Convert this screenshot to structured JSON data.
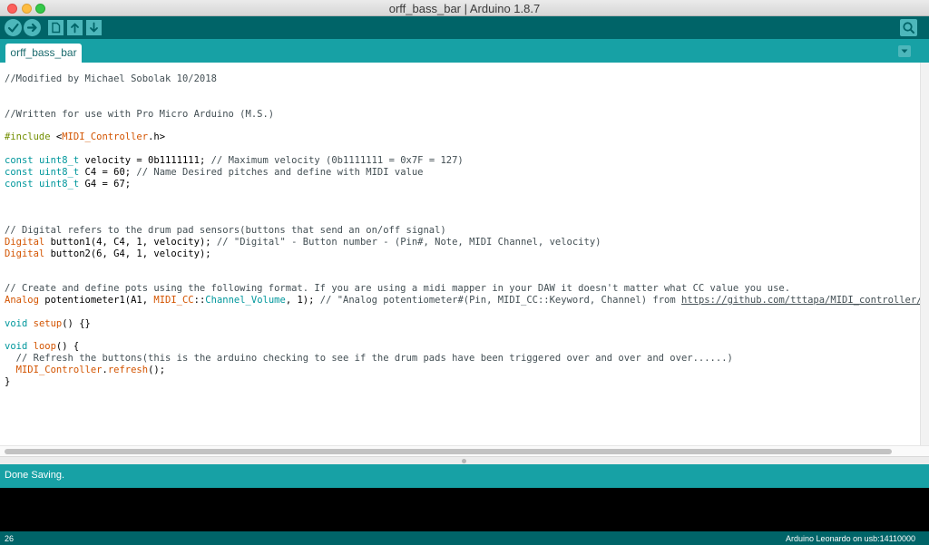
{
  "window": {
    "title": "orff_bass_bar | Arduino 1.8.7"
  },
  "toolbar": {
    "buttons": [
      {
        "name": "verify",
        "icon": "check-icon"
      },
      {
        "name": "upload",
        "icon": "arrow-right-icon"
      },
      {
        "name": "new",
        "icon": "new-file-icon"
      },
      {
        "name": "open",
        "icon": "arrow-up-icon"
      },
      {
        "name": "save",
        "icon": "arrow-down-icon"
      }
    ],
    "serial_monitor_icon": "magnifier-icon"
  },
  "tabs": [
    {
      "label": "orff_bass_bar",
      "active": true
    }
  ],
  "tab_menu_icon": "chevron-down-icon",
  "editor": {
    "lines": [
      [
        {
          "t": "//Modified by Michael Sobolak 10/2018",
          "c": "cm"
        }
      ],
      [],
      [],
      [
        {
          "t": "//Written for use with Pro Micro Arduino (M.S.)",
          "c": "cm"
        }
      ],
      [],
      [
        {
          "t": "#include",
          "c": "kw"
        },
        {
          "t": " <"
        },
        {
          "t": "MIDI_Controller",
          "c": "fn"
        },
        {
          "t": ".h>"
        }
      ],
      [],
      [
        {
          "t": "const",
          "c": "ty"
        },
        {
          "t": " "
        },
        {
          "t": "uint8_t",
          "c": "ty"
        },
        {
          "t": " velocity = 0b1111111; "
        },
        {
          "t": "// Maximum velocity (0b1111111 = 0x7F = 127)",
          "c": "cm"
        }
      ],
      [
        {
          "t": "const",
          "c": "ty"
        },
        {
          "t": " "
        },
        {
          "t": "uint8_t",
          "c": "ty"
        },
        {
          "t": " C4 = 60; "
        },
        {
          "t": "// Name Desired pitches and define with MIDI value",
          "c": "cm"
        }
      ],
      [
        {
          "t": "const",
          "c": "ty"
        },
        {
          "t": " "
        },
        {
          "t": "uint8_t",
          "c": "ty"
        },
        {
          "t": " G4 = 67;"
        }
      ],
      [],
      [],
      [],
      [
        {
          "t": "// Digital refers to the drum pad sensors(buttons that send an on/off signal)",
          "c": "cm"
        }
      ],
      [
        {
          "t": "Digital",
          "c": "fn"
        },
        {
          "t": " button1(4, C4, 1, velocity); "
        },
        {
          "t": "// \"Digital\" - Button number - (Pin#, Note, MIDI Channel, velocity)",
          "c": "cm"
        }
      ],
      [
        {
          "t": "Digital",
          "c": "fn"
        },
        {
          "t": " button2(6, G4, 1, velocity);"
        }
      ],
      [],
      [],
      [
        {
          "t": "// Create and define pots using the following format. If you are using a midi mapper in your DAW it doesn't matter what CC value you use.",
          "c": "cm"
        }
      ],
      [
        {
          "t": "Analog",
          "c": "fn"
        },
        {
          "t": " potentiometer1(A1, "
        },
        {
          "t": "MIDI_CC",
          "c": "fn"
        },
        {
          "t": "::"
        },
        {
          "t": "Channel_Volume",
          "c": "ty"
        },
        {
          "t": ", 1); "
        },
        {
          "t": "// \"Analog potentiometer#(Pin, MIDI_CC::Keyword, Channel) from ",
          "c": "cm"
        },
        {
          "t": "https://github.com/tttapa/MIDI_controller/blob/master/keywords",
          "c": "cm url"
        }
      ],
      [],
      [
        {
          "t": "void",
          "c": "ty"
        },
        {
          "t": " "
        },
        {
          "t": "setup",
          "c": "fn"
        },
        {
          "t": "() {}"
        }
      ],
      [],
      [
        {
          "t": "void",
          "c": "ty"
        },
        {
          "t": " "
        },
        {
          "t": "loop",
          "c": "fn"
        },
        {
          "t": "() {"
        }
      ],
      [
        {
          "t": "  "
        },
        {
          "t": "// Refresh the buttons(this is the arduino checking to see if the drum pads have been triggered over and over and over......)",
          "c": "cm"
        }
      ],
      [
        {
          "t": "  "
        },
        {
          "t": "MIDI_Controller",
          "c": "fn"
        },
        {
          "t": "."
        },
        {
          "t": "refresh",
          "c": "fn"
        },
        {
          "t": "();"
        }
      ],
      [
        {
          "t": "}"
        }
      ]
    ]
  },
  "status": {
    "message": "Done Saving."
  },
  "footer": {
    "line": "26",
    "board": "Arduino Leonardo on usb:14110000"
  },
  "colors": {
    "toolbar": "#006468",
    "tabbar": "#17a1a5",
    "button": "#4db7bb",
    "console": "#000000"
  }
}
